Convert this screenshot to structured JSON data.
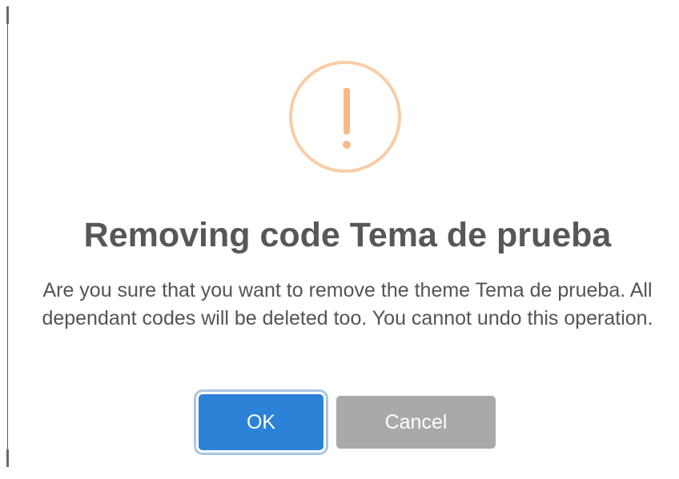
{
  "dialog": {
    "icon": "warning-exclamation-icon",
    "title": "Removing code Tema de prueba",
    "message": "Are you sure that you want to remove the theme Tema de prueba. All dependant codes will be deleted too. You cannot undo this operation.",
    "ok_label": "OK",
    "cancel_label": "Cancel"
  },
  "colors": {
    "icon_ring": "#f9cda7",
    "icon_mark": "#f7b98a",
    "title_text": "#575757",
    "ok_button": "#2b82d7",
    "cancel_button": "#a9a9a9"
  }
}
